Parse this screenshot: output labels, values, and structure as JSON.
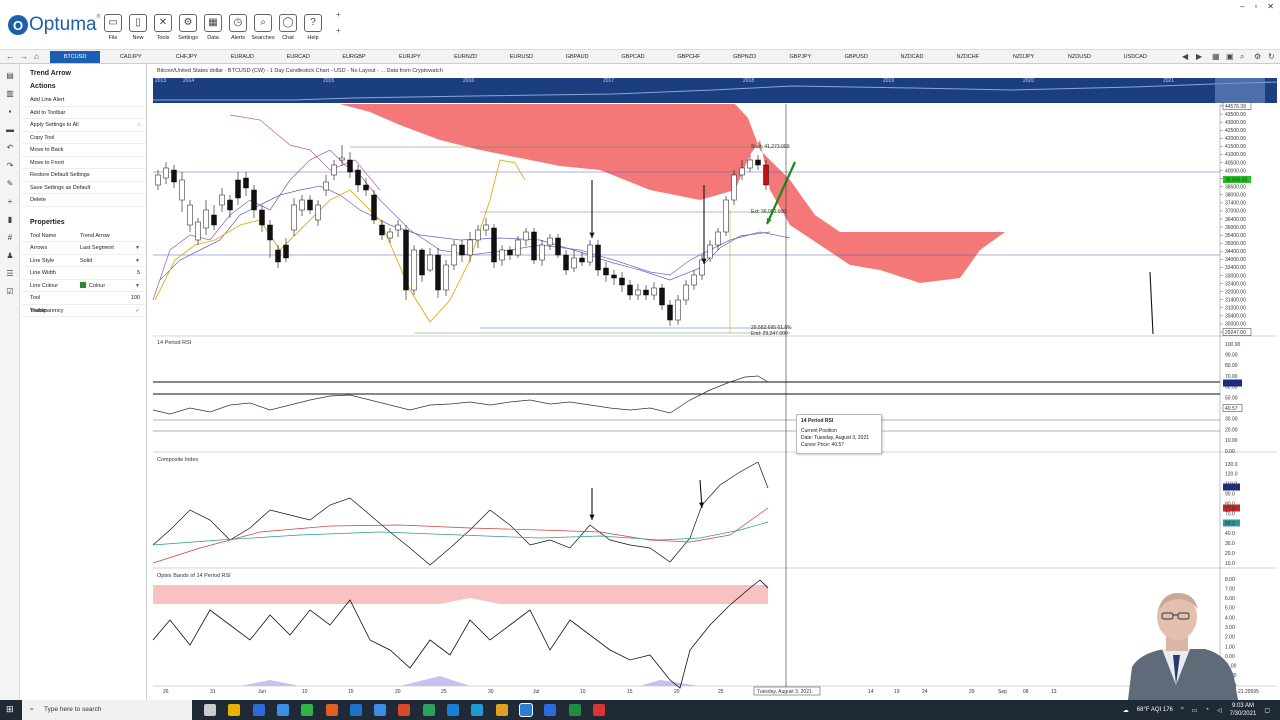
{
  "app": {
    "logo_text": "Optuma",
    "ribbon": [
      {
        "label": "File",
        "icon": "folder-icon"
      },
      {
        "label": "New",
        "icon": "new-document-icon"
      },
      {
        "label": "Tools",
        "icon": "tools-icon"
      },
      {
        "label": "Settings",
        "icon": "gear-icon"
      },
      {
        "label": "Data",
        "icon": "data-icon"
      },
      {
        "label": "Alerts",
        "icon": "alarm-clock-icon"
      },
      {
        "label": "Searches",
        "icon": "search-icon"
      },
      {
        "label": "Chat",
        "icon": "chat-bubble-icon"
      },
      {
        "label": "Help",
        "icon": "help-icon"
      }
    ]
  },
  "symbols": [
    "BTCUSD",
    "CADJPY",
    "CHFJPY",
    "EURAUD",
    "EURCAD",
    "EURGBP",
    "EURJPY",
    "EURNZD",
    "EURUSD",
    "GBPAUD",
    "GBPCAD",
    "GBPCHF",
    "GBPNZD",
    "GBPJPY",
    "GBPUSD",
    "NZDCAD",
    "NZDCHF",
    "NZDJPY",
    "NZDUSD",
    "USDCAD"
  ],
  "active_symbol": "BTCUSD",
  "panel": {
    "title": "Trend Arrow",
    "actions_heading": "Actions",
    "actions": [
      "Add Line Alert",
      "Add to Toolbar",
      "Apply Settings to All",
      "Copy Tool",
      "Move to Back",
      "Move to Front",
      "Restore Default Settings",
      "Save Settings as Default",
      "Delete"
    ],
    "properties_heading": "Properties",
    "properties": [
      {
        "key": "Tool Name",
        "value": "Trend Arrow"
      },
      {
        "key": "Arrows",
        "value": "Last Segment"
      },
      {
        "key": "Line Style",
        "value": "Solid"
      },
      {
        "key": "Line Width",
        "value": "5"
      },
      {
        "key": "Line Colour",
        "value": "Colour"
      },
      {
        "key": "Tool Transparency",
        "value": "100"
      },
      {
        "key": "Visible",
        "value": "✓"
      }
    ]
  },
  "chart": {
    "title": "Bitcoin/United States dollar - BTCUSD (CW) - 1 Day Candlestick Chart - USD - No Layout - ... Data from Cryptowatch",
    "overview_years": [
      "2013",
      "2014",
      "2015",
      "2016",
      "2017",
      "2018",
      "2019",
      "2020",
      "2021"
    ],
    "price_axis": [
      "44576.39",
      "43500.00",
      "43000.00",
      "42500.00",
      "42000.00",
      "41500.00",
      "41000.00",
      "40500.00",
      "40000.00",
      "39500.00",
      "38500.00",
      "38000.00",
      "37400.00",
      "37000.00",
      "36400.00",
      "36000.00",
      "35400.00",
      "35000.00",
      "34400.00",
      "34000.00",
      "33400.00",
      "33000.00",
      "32400.00",
      "32000.00",
      "31400.00",
      "31000.00",
      "30400.00",
      "30000.00",
      "29247.00"
    ],
    "price_highlight": "38,800.00",
    "fib_labels": {
      "start": "Start: 41,273.000",
      "ext": "Ext: 36,000.000",
      "mid": "29,582.695   61.8%",
      "end": "End: 29,247.000"
    },
    "rsi_title": "14 Period RSI",
    "rsi_axis": [
      "100.00",
      "90.00",
      "80.00",
      "70.00",
      "60.00",
      "50.00",
      "40.00",
      "30.00",
      "20.00",
      "10.00",
      "0.00"
    ],
    "rsi_value": "64.13",
    "rsi_cursor": "40.57",
    "composite_title": "Composite Index",
    "composite_axis": [
      "130.0",
      "120.0",
      "110.0",
      "90.0",
      "80.0",
      "70.0",
      "50.0",
      "40.0",
      "30.0",
      "20.0",
      "10.0"
    ],
    "composite_badges": [
      "102.3",
      "77.8",
      "58.3"
    ],
    "optex_title": "Optex Bands of 14 Period RSI",
    "optex_axis": [
      "8.00",
      "7.00",
      "6.00",
      "5.00",
      "4.00",
      "3.00",
      "2.00",
      "1.00",
      "0.00",
      "-1.00",
      "-2.00",
      "-3.00"
    ],
    "date_axis": [
      "26",
      "31",
      "Jun",
      "10",
      "15",
      "20",
      "25",
      "30",
      "Jul",
      "10",
      "15",
      "20",
      "25",
      "Aug",
      "14",
      "19",
      "24",
      "29",
      "Sep",
      "08",
      "13"
    ],
    "cursor_date": "Tuesday, August 3, 2021",
    "corner_value": "21.29595"
  },
  "tooltip": {
    "title": "14 Period RSI",
    "line1": "Current Position",
    "line2": "Date: Tuesday, August 3, 2021",
    "line3": "Cursor Price: 40.57"
  },
  "taskbar": {
    "search_placeholder": "Type here to search",
    "weather": "68°F  AQI 176",
    "time": "9:03 AM",
    "date": "7/30/2021"
  }
}
